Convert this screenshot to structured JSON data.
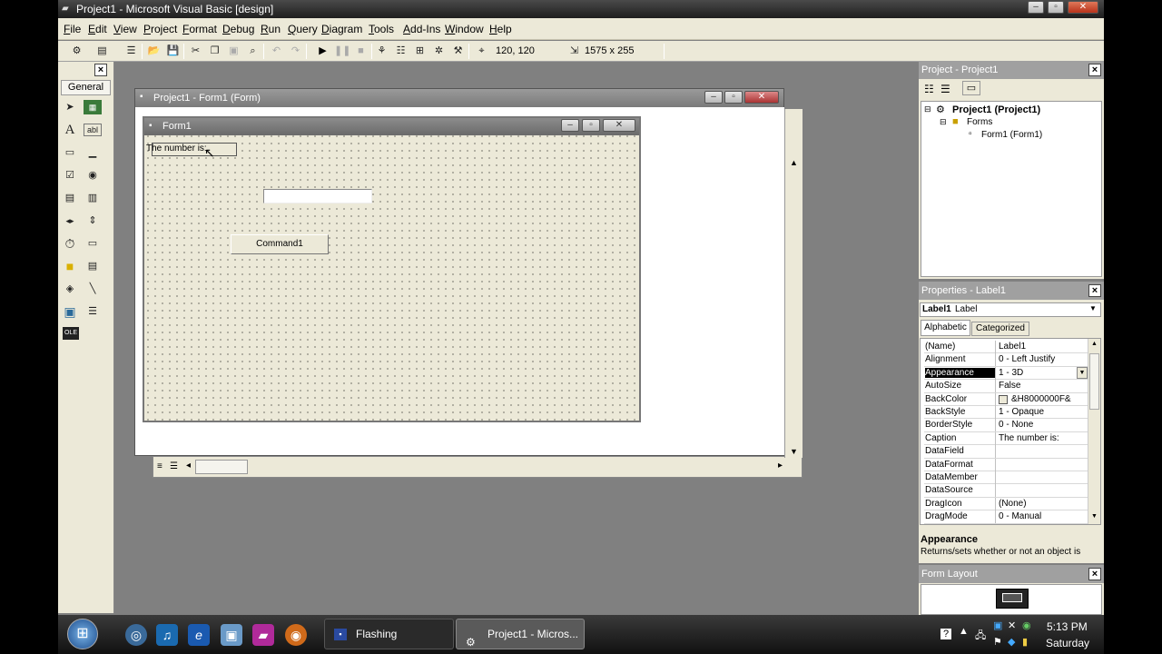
{
  "window": {
    "title": "Project1 - Microsoft Visual Basic [design]"
  },
  "menu": [
    "File",
    "Edit",
    "View",
    "Project",
    "Format",
    "Debug",
    "Run",
    "Query",
    "Diagram",
    "Tools",
    "Add-Ins",
    "Window",
    "Help"
  ],
  "toolbar": {
    "position": "120, 120",
    "size": "1575 x 255"
  },
  "toolbox": {
    "title": "General"
  },
  "designer": {
    "title": "Project1 - Form1 (Form)",
    "form_title": "Form1",
    "label_caption": "The number is:",
    "textbox_value": "",
    "command_caption": "Command1"
  },
  "project": {
    "title": "Project - Project1",
    "root": "Project1 (Project1)",
    "folder": "Forms",
    "form": "Form1 (Form1)"
  },
  "properties": {
    "title": "Properties - Label1",
    "object_name": "Label1",
    "object_type": "Label",
    "tab_alphabetic": "Alphabetic",
    "tab_categorized": "Categorized",
    "rows": [
      {
        "name": "(Name)",
        "value": "Label1"
      },
      {
        "name": "Alignment",
        "value": "0 - Left Justify"
      },
      {
        "name": "Appearance",
        "value": "1 - 3D"
      },
      {
        "name": "AutoSize",
        "value": "False"
      },
      {
        "name": "BackColor",
        "value": "&H8000000F&"
      },
      {
        "name": "BackStyle",
        "value": "1 - Opaque"
      },
      {
        "name": "BorderStyle",
        "value": "0 - None"
      },
      {
        "name": "Caption",
        "value": "The number is:"
      },
      {
        "name": "DataField",
        "value": ""
      },
      {
        "name": "DataFormat",
        "value": ""
      },
      {
        "name": "DataMember",
        "value": ""
      },
      {
        "name": "DataSource",
        "value": ""
      },
      {
        "name": "DragIcon",
        "value": "(None)"
      },
      {
        "name": "DragMode",
        "value": "0 - Manual"
      }
    ],
    "desc_title": "Appearance",
    "desc_text": "Returns/sets whether or not an object is"
  },
  "form_layout": {
    "title": "Form Layout"
  },
  "taskbar": {
    "tasks": [
      "Flashing",
      "Project1 - Micros..."
    ],
    "time": "5:13 PM",
    "day": "Saturday"
  },
  "colors": {
    "titlebar": "#2a2a2a",
    "mdi_background": "#808080",
    "selected_row": "#000000"
  }
}
